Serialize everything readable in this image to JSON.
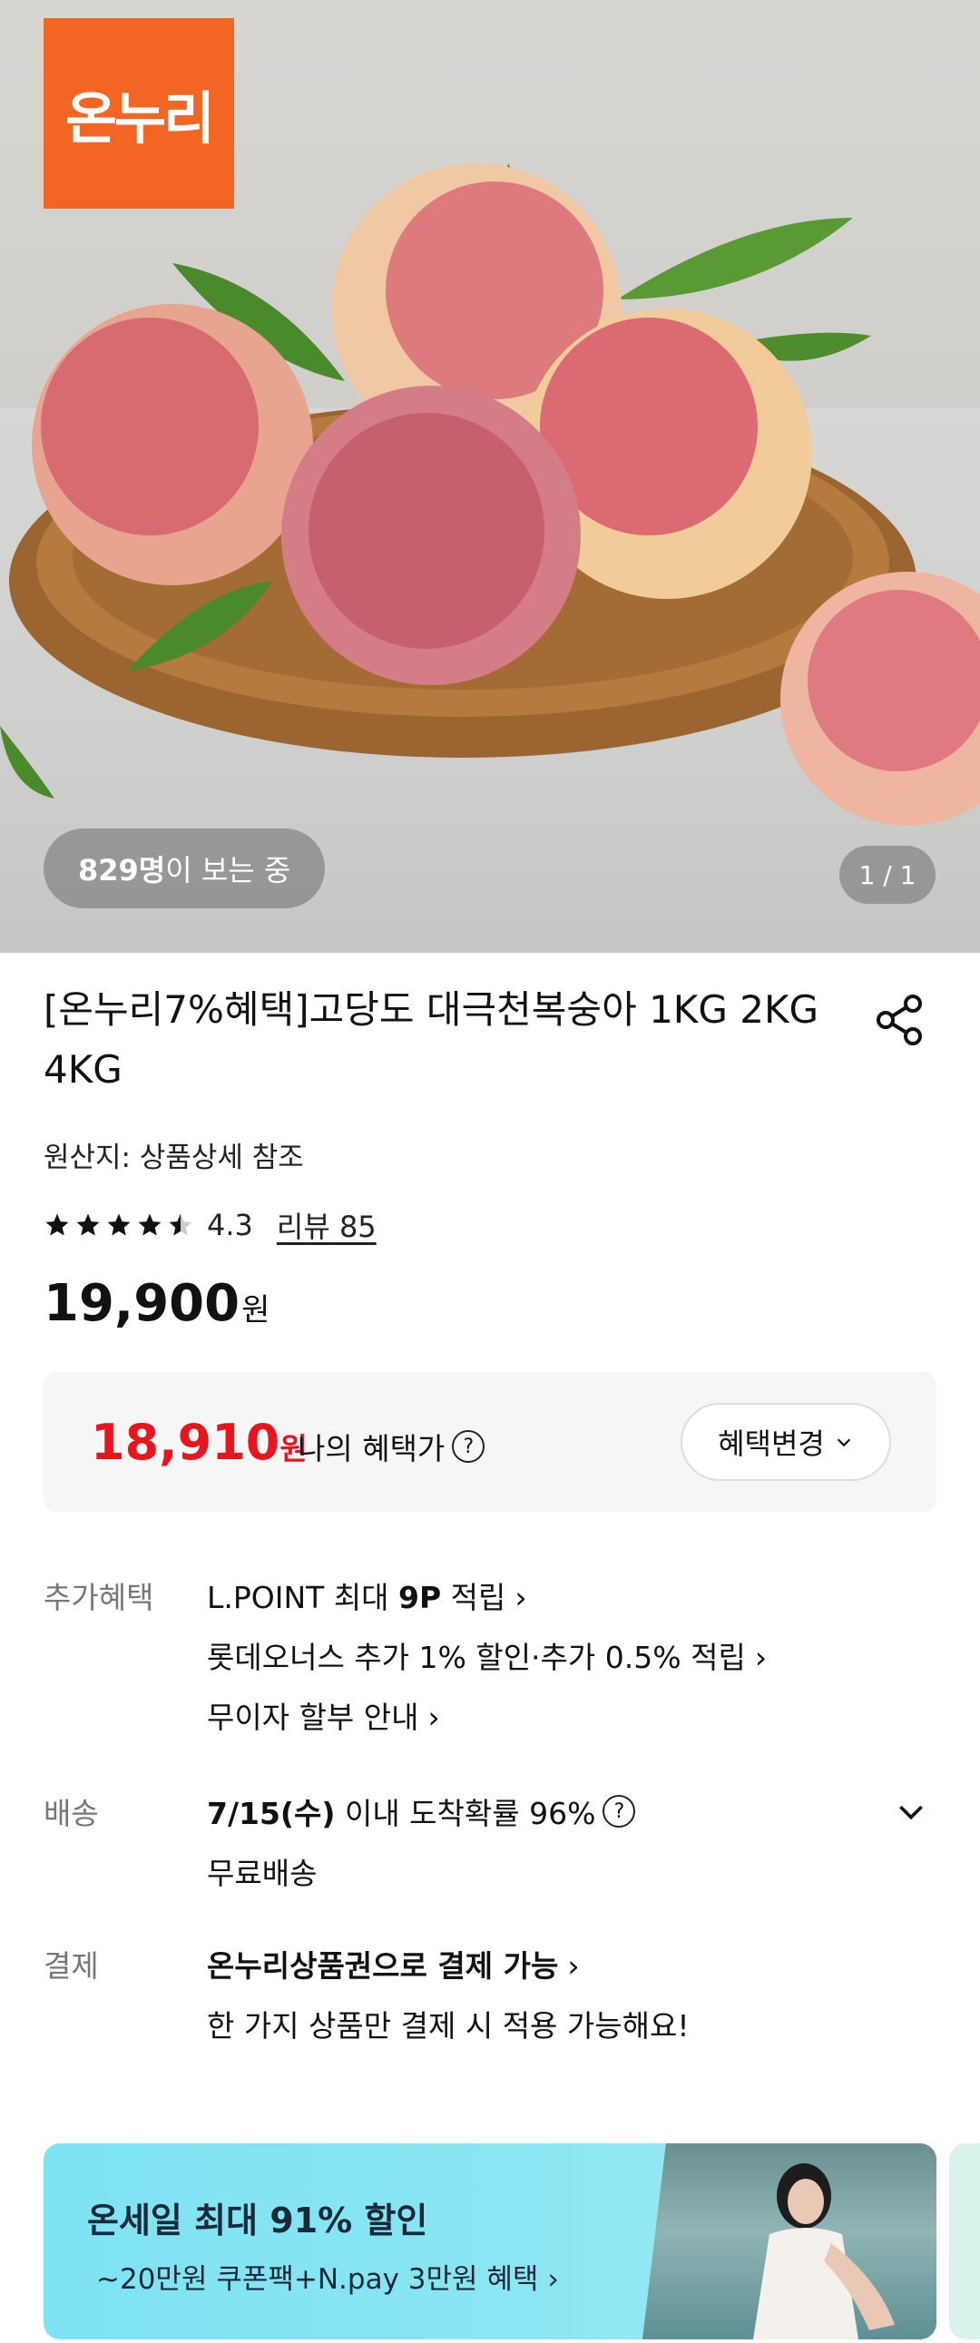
{
  "hero": {
    "logo_text": "온누리",
    "viewer_count": "829명",
    "viewer_suffix": "이 보는 중",
    "page_indicator": "1 / 1"
  },
  "product": {
    "title": "[온누리7%혜택]고당도 대극천복숭아 1KG 2KG 4KG",
    "origin": "원산지: 상품상세 참조",
    "rating": "4.3",
    "rating_value": 4.3,
    "review_link": "리뷰 85",
    "price": "19,900",
    "price_unit": "원"
  },
  "benefit": {
    "price": "18,910",
    "price_unit": "원",
    "label": "나의 혜택가",
    "help_icon": "?",
    "change_button": "혜택변경"
  },
  "details": {
    "extra_label": "추가혜택",
    "lpoint_prefix": "L.POINT 최대 ",
    "lpoint_bold": "9P",
    "lpoint_suffix": " 적립",
    "lotte_line": "롯데오너스 추가 1% 할인·추가 0.5% 적립",
    "installment_line": "무이자 할부 안내",
    "delivery_label": "배송",
    "delivery_date": "7/15(수)",
    "delivery_text": " 이내 도착확률 96%",
    "delivery_fee": "무료배송",
    "payment_label": "결제",
    "payment_line": "온누리상품권으로 결제 가능",
    "payment_note": "한 가지 상품만 결제 시 적용 가능해요!"
  },
  "promo": {
    "title": "온세일 최대 91% 할인",
    "subtitle": "~20만원 쿠폰팩+N.pay 3만원 혜택"
  },
  "colors": {
    "logo_bg": "#f26522",
    "benefit_price": "#e8141e",
    "promo_bg": "#8ae6f2"
  }
}
